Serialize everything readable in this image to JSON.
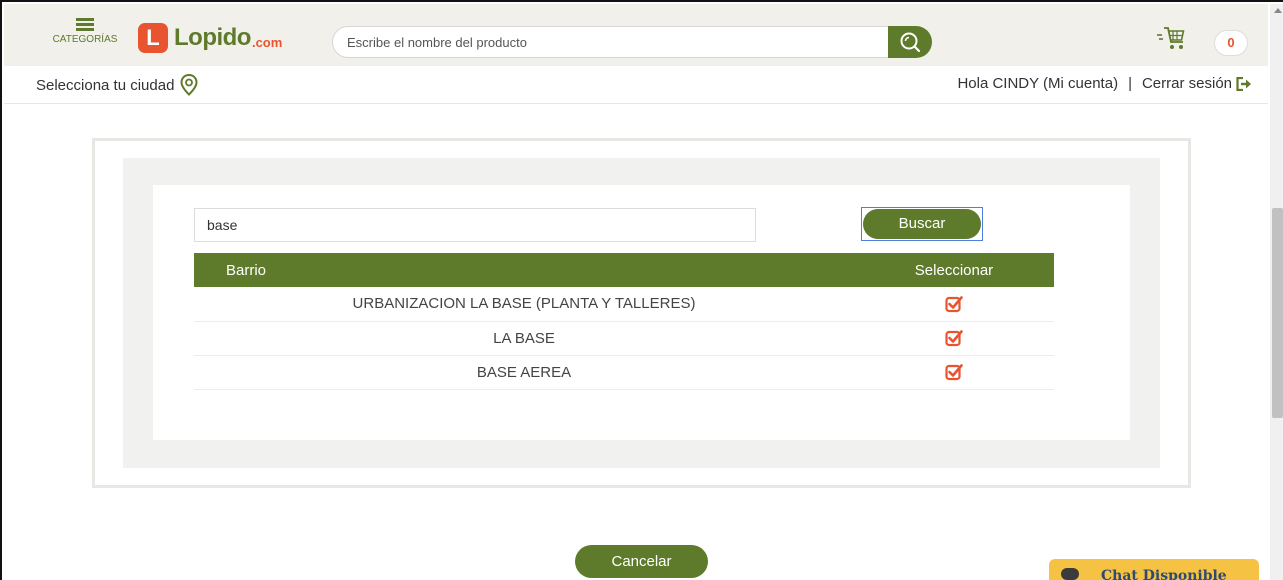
{
  "header": {
    "menu_label": "CATEGORÍAS",
    "logo_mark": "L",
    "logo_text": "Lopido",
    "logo_suffix": ".com",
    "search_placeholder": "Escribe el nombre del producto",
    "cart_count": "0",
    "brand_green": "#5e7a2b",
    "brand_orange": "#e8542f"
  },
  "subheader": {
    "city_label": "Selecciona tu ciudad",
    "greeting": "Hola CINDY (Mi cuenta)",
    "separator": "|",
    "logout_label": "Cerrar sesión"
  },
  "selector": {
    "search_value": "base",
    "search_button": "Buscar",
    "columns": [
      "Barrio",
      "Seleccionar"
    ],
    "rows": [
      {
        "barrio": "URBANIZACION LA BASE (PLANTA Y TALLERES)"
      },
      {
        "barrio": "LA BASE"
      },
      {
        "barrio": "BASE AEREA"
      }
    ],
    "cancel_button": "Cancelar"
  },
  "chat": {
    "label": "Chat Disponible"
  }
}
